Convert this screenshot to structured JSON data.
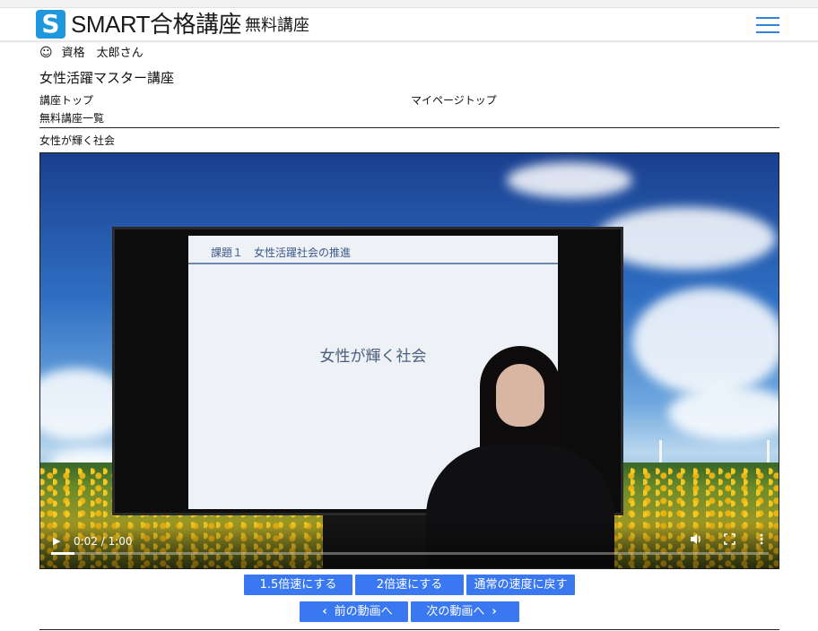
{
  "header": {
    "logo_letter": "S",
    "brand": "SMART合格講座",
    "subtitle": "無料講座",
    "menu_icon": "hamburger-icon"
  },
  "user": {
    "icon": "smiley-icon",
    "name": "資格　太郎さん"
  },
  "course": {
    "title": "女性活躍マスター講座"
  },
  "nav": {
    "course_top": "講座トップ",
    "mypage_top": "マイページトップ",
    "free_list": "無料講座一覧"
  },
  "video": {
    "title": "女性が輝く社会",
    "slide_heading": "課題１　女性活躍社会の推進",
    "slide_text": "女性が輝く社会",
    "time": "0:02 / 1:00",
    "progress": 0.033,
    "icons": [
      "play-icon",
      "volume-icon",
      "fullscreen-icon",
      "more-options-icon"
    ]
  },
  "speed_buttons": {
    "x15": "1.5倍速にする",
    "x2": "2倍速にする",
    "normal": "通常の速度に戻す"
  },
  "nav_buttons": {
    "prev": "前の動画へ",
    "next": "次の動画へ"
  },
  "colors": {
    "accent": "#3a78f2",
    "logo": "#1f97dc",
    "menu": "#2b86d8"
  }
}
